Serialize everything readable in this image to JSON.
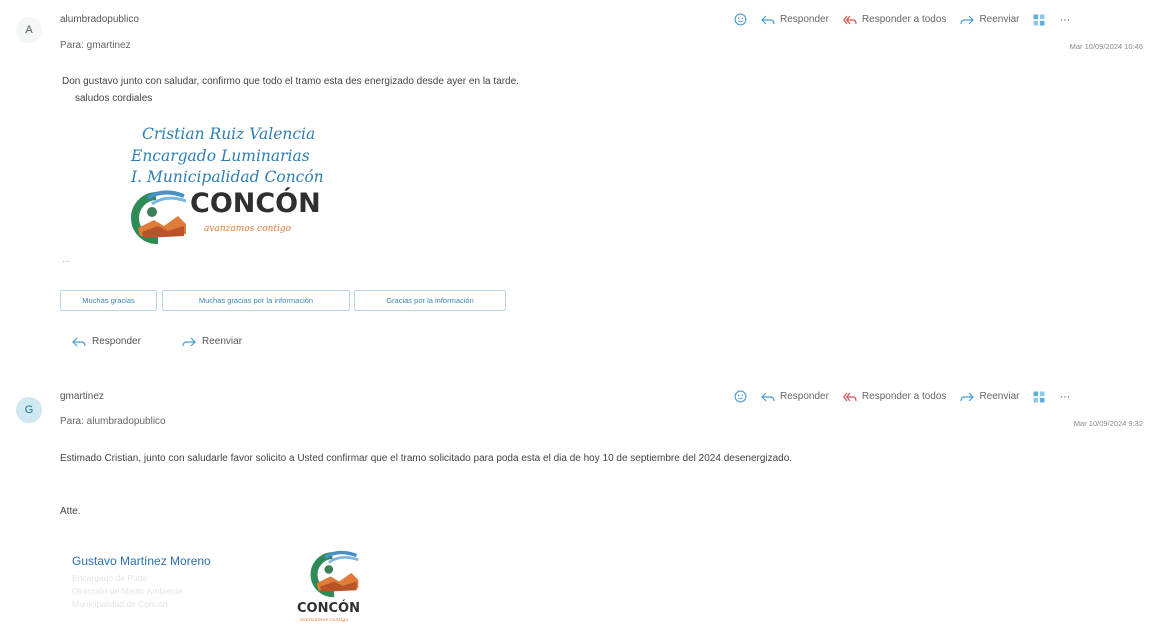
{
  "colors": {
    "accent": "#3d86b6",
    "reply_all": "#d9534f",
    "logo_orange": "#e07b39",
    "logo_blue": "#4a90c8"
  },
  "actions": {
    "reply": "Responder",
    "reply_all": "Responder a todos",
    "forward": "Reenviar",
    "more": "···"
  },
  "message1": {
    "avatar": "A",
    "sender": "alumbradopublico",
    "to": "Para: gmartinez",
    "date": "Mar 10/09/2024 10:46",
    "body_line1": "Don gustavo junto con saludar, confirmo que todo el tramo esta des energizado desde ayer en la tarde.",
    "body_line2": "saludos cordiales",
    "signature": {
      "line1": "Cristian Ruiz Valencia",
      "line2": "Encargado   Luminarias",
      "line3": "I. Municipalidad Concón",
      "logo_word": "CONCÓN",
      "logo_tagline": "avanzamos contigo"
    },
    "ellipsis": "...",
    "quick_replies": [
      "Muchas gracias",
      "Muchas gracias por la información",
      "Gracias por la información"
    ],
    "footer_reply": "Responder",
    "footer_forward": "Reenviar"
  },
  "message2": {
    "avatar": "G",
    "sender": "gmartinez",
    "to": "Para: alumbradopublico",
    "date": "Mar 10/09/2024 9:32",
    "body_line1": "Estimado Cristian, junto con saludarle favor solicito a Usted confirmar que el tramo solicitado para poda esta el dia de hoy 10 de septiembre del 2024 desenergizado.",
    "atte": "Atte.",
    "signature": {
      "name": "Gustavo Martínez Moreno",
      "faded_line1": "Encargado de Poda",
      "faded_line2": "Dirección de Medio Ambiente",
      "faded_line3": "Municipalidad de Concón",
      "logo_word": "CONCÓN",
      "logo_tagline": "avanzamos contigo"
    }
  }
}
